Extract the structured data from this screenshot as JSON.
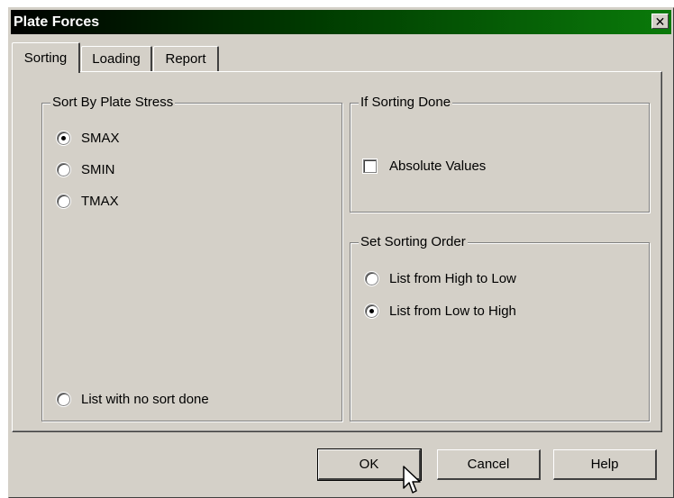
{
  "window": {
    "title": "Plate Forces"
  },
  "tabs": [
    {
      "label": "Sorting",
      "active": true
    },
    {
      "label": "Loading",
      "active": false
    },
    {
      "label": "Report",
      "active": false
    }
  ],
  "sort_by": {
    "legend": "Sort By Plate Stress",
    "options": [
      {
        "label": "SMAX",
        "selected": true
      },
      {
        "label": "SMIN",
        "selected": false
      },
      {
        "label": "TMAX",
        "selected": false
      }
    ],
    "no_sort": {
      "label": "List with no sort done",
      "selected": false
    }
  },
  "if_sorting_done": {
    "legend": "If Sorting Done",
    "absolute_values": {
      "label": "Absolute Values",
      "checked": false
    }
  },
  "sorting_order": {
    "legend": "Set Sorting Order",
    "options": [
      {
        "label": "List from High to Low",
        "selected": false
      },
      {
        "label": "List from Low to High",
        "selected": true
      }
    ]
  },
  "buttons": {
    "ok": "OK",
    "cancel": "Cancel",
    "help": "Help"
  },
  "icons": {
    "close": "close-icon",
    "cursor": "mouse-pointer-icon"
  },
  "colors": {
    "face": "#d4d0c8",
    "titlebar_start": "#000000",
    "titlebar_end": "#0a7a0a"
  }
}
